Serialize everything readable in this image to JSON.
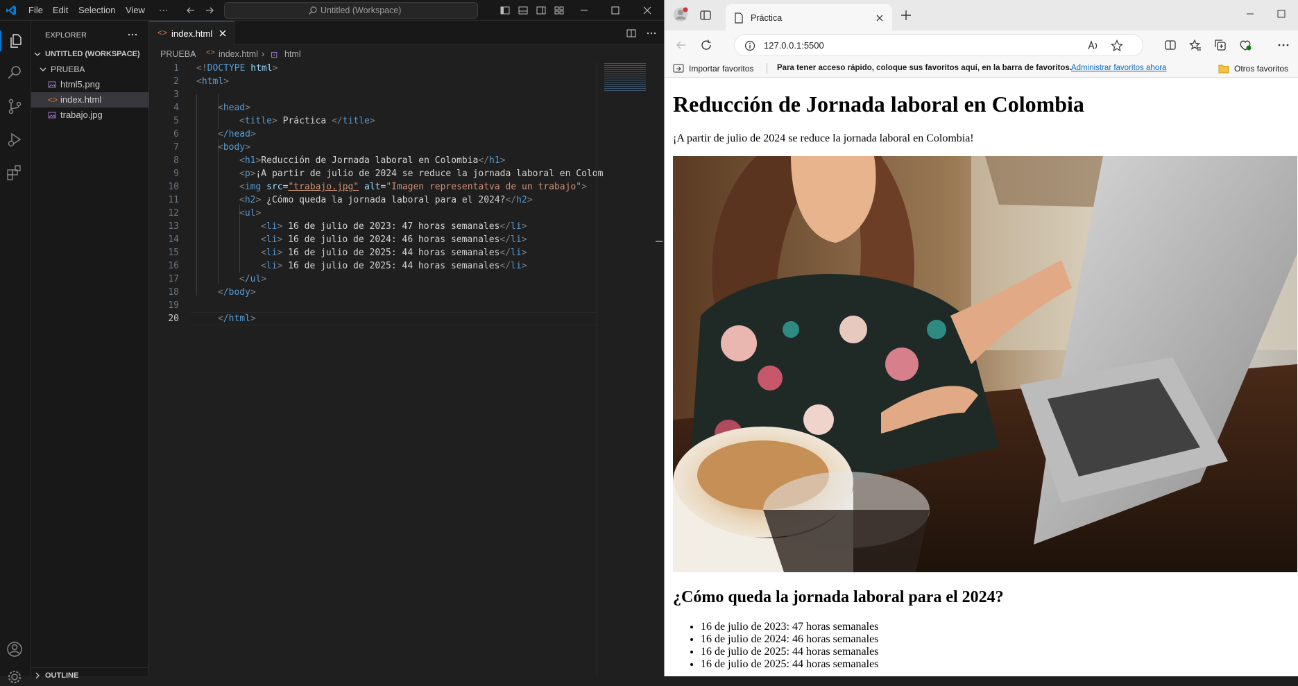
{
  "vscode": {
    "menu": [
      "File",
      "Edit",
      "Selection",
      "View",
      "···"
    ],
    "search_placeholder": "Untitled (Workspace)",
    "explorer_title": "EXPLORER",
    "workspace_label": "UNTITLED (WORKSPACE)",
    "folder": "PRUEBA",
    "files": [
      "html5.png",
      "index.html",
      "trabajo.jpg"
    ],
    "outline_label": "OUTLINE",
    "active_tab": "index.html",
    "breadcrumb": [
      "PRUEBA",
      "index.html",
      "html"
    ],
    "line_numbers": [
      "1",
      "2",
      "3",
      "4",
      "5",
      "6",
      "7",
      "8",
      "9",
      "10",
      "11",
      "12",
      "13",
      "14",
      "15",
      "16",
      "17",
      "18",
      "19",
      "20"
    ],
    "code": {
      "l1": {
        "open": "<!",
        "kw": "DOCTYPE",
        "sp": " ",
        "val": "html",
        "close": ">"
      },
      "l2": {
        "tag": "html"
      },
      "l4": {
        "tag": "head"
      },
      "l5": {
        "tag": "title",
        "text": " Práctica ",
        "end": "title"
      },
      "l6": {
        "tag": "/head"
      },
      "l7": {
        "tag": "body"
      },
      "l8": {
        "tag": "h1",
        "text": "Reducción de Jornada laboral en Colombia",
        "end": "h1"
      },
      "l9": {
        "tag": "p",
        "text": "¡A partir de julio de 2024 se reduce la jornada laboral en Colom"
      },
      "l10": {
        "tag": "img",
        "a1": "src",
        "v1": "\"trabajo.jpg\"",
        "a2": "alt",
        "v2": "\"Imagen representatva de un trabajo\""
      },
      "l11": {
        "tag": "h2",
        "text": " ¿Cómo queda la jornada laboral para el 2024?",
        "end": "h2"
      },
      "l12": {
        "tag": "ul"
      },
      "li": [
        " 16 de julio de 2023: 47 horas semanales",
        " 16 de julio de 2024: 46 horas semanales",
        " 16 de julio de 2025: 44 horas semanales",
        " 16 de julio de 2025: 44 horas semanales"
      ],
      "l17": {
        "tag": "/ul"
      },
      "l18": {
        "tag": "/body"
      },
      "l20": {
        "tag": "/html"
      }
    }
  },
  "edge": {
    "tab_title": "Práctica",
    "url": "127.0.0.1:5500",
    "fav_import": "Importar favoritos",
    "fav_hint": "Para tener acceso rápido, coloque sus favoritos aquí, en la barra de favoritos.",
    "fav_manage": "Administrar favoritos ahora",
    "fav_other": "Otros favoritos"
  },
  "page": {
    "h1": "Reducción de Jornada laboral en Colombia",
    "lead": "¡A partir de julio de 2024 se reduce la jornada laboral en Colombia!",
    "h2": "¿Cómo queda la jornada laboral para el 2024?",
    "items": [
      "16 de julio de 2023: 47 horas semanales",
      "16 de julio de 2024: 46 horas semanales",
      "16 de julio de 2025: 44 horas semanales",
      "16 de julio de 2025: 44 horas semanales"
    ]
  },
  "colors": {
    "vscode_bg": "#1f1f1f",
    "tag_blue": "#569cd6",
    "attr": "#9cdcfe",
    "string": "#ce9178",
    "accent": "#0078d4"
  }
}
